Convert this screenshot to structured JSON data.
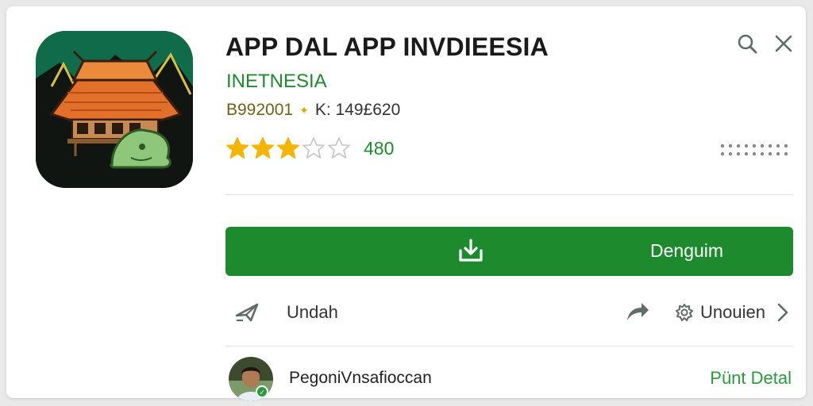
{
  "app": {
    "title": "APP DAL APP INVDIEESIA",
    "developer": "INETNESIA",
    "meta_left": "B992001",
    "meta_separator": "✦",
    "meta_right": "K: 149£620",
    "rating": 3,
    "rating_max": 5,
    "rating_count": "480",
    "icon": "traditional-house-icon"
  },
  "actions": {
    "install_label": "Denguim",
    "share_label": "Undah",
    "settings_label": "Unouien"
  },
  "author": {
    "name": "PegoniVnsafioccan",
    "detail_link": "Pünt Detal"
  },
  "colors": {
    "accent_green": "#1e8a2e",
    "star_gold": "#f4b400",
    "icon_grey": "#5f6b66"
  }
}
